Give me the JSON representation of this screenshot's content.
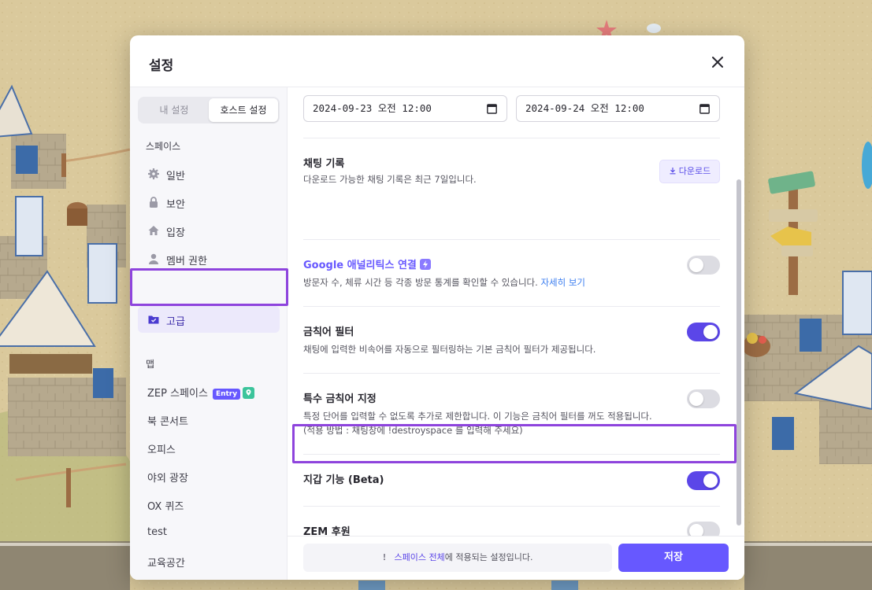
{
  "modal": {
    "title": "설정",
    "close_icon": "close-icon"
  },
  "sidebar": {
    "tabs": [
      "내 설정",
      "호스트 설정"
    ],
    "active_tab": "호스트 설정",
    "space_section_label": "스페이스",
    "items": [
      {
        "label": "일반",
        "icon": "gear-icon"
      },
      {
        "label": "보안",
        "icon": "lock-icon"
      },
      {
        "label": "입장",
        "icon": "home-icon"
      },
      {
        "label": "멤버 권한",
        "icon": "user-icon"
      },
      {
        "label": "고급",
        "icon": "folder-icon",
        "active": true
      }
    ],
    "map_section_label": "맵",
    "maps": [
      "ZEP 스페이스",
      "북 콘서트",
      "오피스",
      "야외 광장",
      "OX 퀴즈",
      "test",
      "교육공간"
    ],
    "entry_badge": "Entry"
  },
  "content": {
    "date_start": "2024-09-23 오전 12:00",
    "date_end": "2024-09-24 오전 12:00",
    "chat_log": {
      "title": "채팅 기록",
      "desc": "다운로드 가능한 채팅 기록은 최근 7일입니다.",
      "download_label": "다운로드"
    },
    "google_analytics": {
      "title": "Google 애널리틱스 연결",
      "desc": "방문자 수, 체류 시간 등 각종 방문 통계를 확인할 수 있습니다.",
      "link": "자세히 보기",
      "enabled": false
    },
    "profanity_filter": {
      "title": "금칙어 필터",
      "desc": "채팅에 입력한 비속어를 자동으로 필터링하는 기본 금칙어 필터가 제공됩니다.",
      "enabled": true
    },
    "custom_profanity": {
      "title": "특수 금칙어 지정",
      "desc_line1": "특정 단어를 입력할 수 없도록 추가로 제한합니다. 이 기능은 금칙어 필터를 꺼도 적용됩니다.",
      "desc_line2": "(적용 방법 : 채팅창에 !destroyspace 를 입력해 주세요)",
      "enabled": false
    },
    "wallet": {
      "title": "지갑 기능 (Beta)",
      "enabled": true
    },
    "zem_support": {
      "title": "ZEM 후원",
      "enabled": false
    }
  },
  "footer": {
    "notice_icon": "!",
    "notice_strong": "스페이스 전체",
    "notice_rest": "에 적용되는 설정입니다.",
    "save_label": "저장"
  },
  "colors": {
    "accent": "#6758ff",
    "highlight_border": "#8e44dd",
    "toggle_on": "#5b46e8",
    "toggle_off": "#dcdce2"
  }
}
